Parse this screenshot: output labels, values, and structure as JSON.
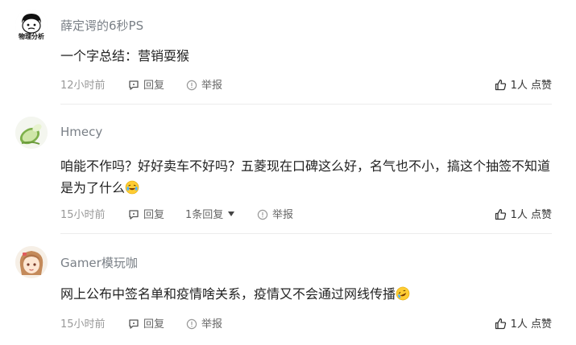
{
  "comments": [
    {
      "username": "薛定谔的6秒PS",
      "avatar_icon": "meme-face-avatar-icon",
      "avatar_text": "物理分析",
      "content": "一个字总结：营销耍猴",
      "time": "12小时前",
      "reply_label": "回复",
      "report_label": "举报",
      "like_label": "1人 点赞"
    },
    {
      "username": "Hmecy",
      "avatar_icon": "cucumber-avatar-icon",
      "content": "咱能不作吗？好好卖车不好吗？五菱现在口碑这么好，名气也不小，搞这个抽签不知道是为了什么",
      "emoji": "laughing-crying-emoji-icon",
      "time": "15小时前",
      "reply_label": "回复",
      "replies_label": "1条回复",
      "report_label": "举报",
      "like_label": "1人 点赞"
    },
    {
      "username": "Gamer模玩咖",
      "avatar_icon": "anime-girl-avatar-icon",
      "content": "网上公布中签名单和疫情啥关系，疫情又不会通过网线传播",
      "emoji": "rofl-emoji-icon",
      "time": "15小时前",
      "reply_label": "回复",
      "report_label": "举报",
      "like_label": "1人 点赞"
    }
  ],
  "colors": {
    "username": "#7a8087",
    "meta": "#999999",
    "divider": "#ececec"
  }
}
